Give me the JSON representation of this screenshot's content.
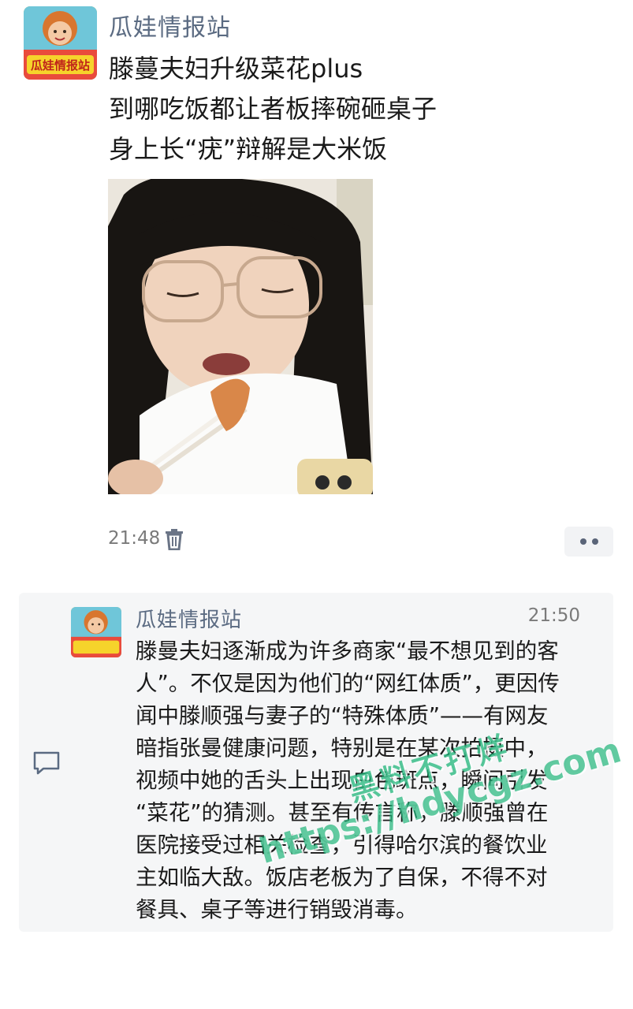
{
  "post": {
    "author": "瓜娃情报站",
    "avatar_badge": "瓜娃情报站",
    "lines": [
      "滕蔓夫妇升级菜花plus",
      "到哪吃饭都让者板摔碗砸桌子",
      "身上长“疣”辩解是大米饭"
    ],
    "time": "21:48",
    "icons": {
      "delete": "trash-icon",
      "more": "more-dots-icon"
    }
  },
  "comment": {
    "author": "瓜娃情报站",
    "time": "21:50",
    "lines": [
      "滕曼夫妇逐渐成为许多商家“最不想见到的客",
      "人”。不仅是因为他们的“网红体质”，更因传",
      "闻中滕顺强与妻子的“特殊体质”——有网友",
      "暗指张曼健康问题，特别是在某次拍摄中，",
      "视频中她的舌头上出现白色斑点，瞬间引发",
      "“菜花”的猜测。甚至有传言称，滕顺强曾在",
      "医院接受过相关检查，引得哈尔滨的餐饮业",
      "主如临大敌。饭店老板为了自保，不得不对",
      "餐具、桌子等进行销毁消毒。"
    ],
    "icon": "comment-icon"
  },
  "watermark": {
    "line1": "黑料不打烊",
    "line2": "https://hdycgz.com"
  },
  "colors": {
    "author_name": "#5b6b82",
    "meta_gray": "#7a7a7a",
    "card_bg": "#f5f6f7",
    "watermark": "#1eb478"
  }
}
